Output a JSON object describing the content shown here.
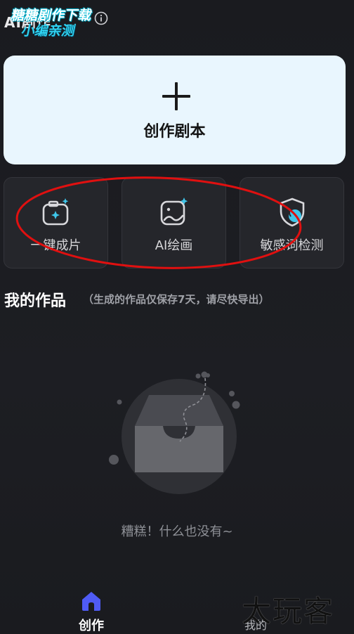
{
  "header": {
    "app_title": "AI剧作",
    "watermark_line1": "糖糖剧作下载",
    "watermark_line2": "小编亲测"
  },
  "create_card": {
    "label": "创作剧本"
  },
  "tools": [
    {
      "label": "一键成片",
      "icon": "sparkle-camera-icon"
    },
    {
      "label": "AI绘画",
      "icon": "sparkle-image-icon"
    },
    {
      "label": "敏感词检测",
      "icon": "shield-check-icon"
    }
  ],
  "works": {
    "title": "我的作品",
    "note": "（生成的作品仅保存7天，请尽快导出）",
    "empty_text": "糟糕！什么也没有~"
  },
  "nav": {
    "home_label": "创作",
    "mine_label": "我的"
  },
  "watermark_bottom": "太玩客",
  "colors": {
    "accent": "#4f5bf5",
    "icon_cyan": "#3fc6ea",
    "card_bg": "#e9f6fe",
    "annotation_red": "#e01010"
  }
}
